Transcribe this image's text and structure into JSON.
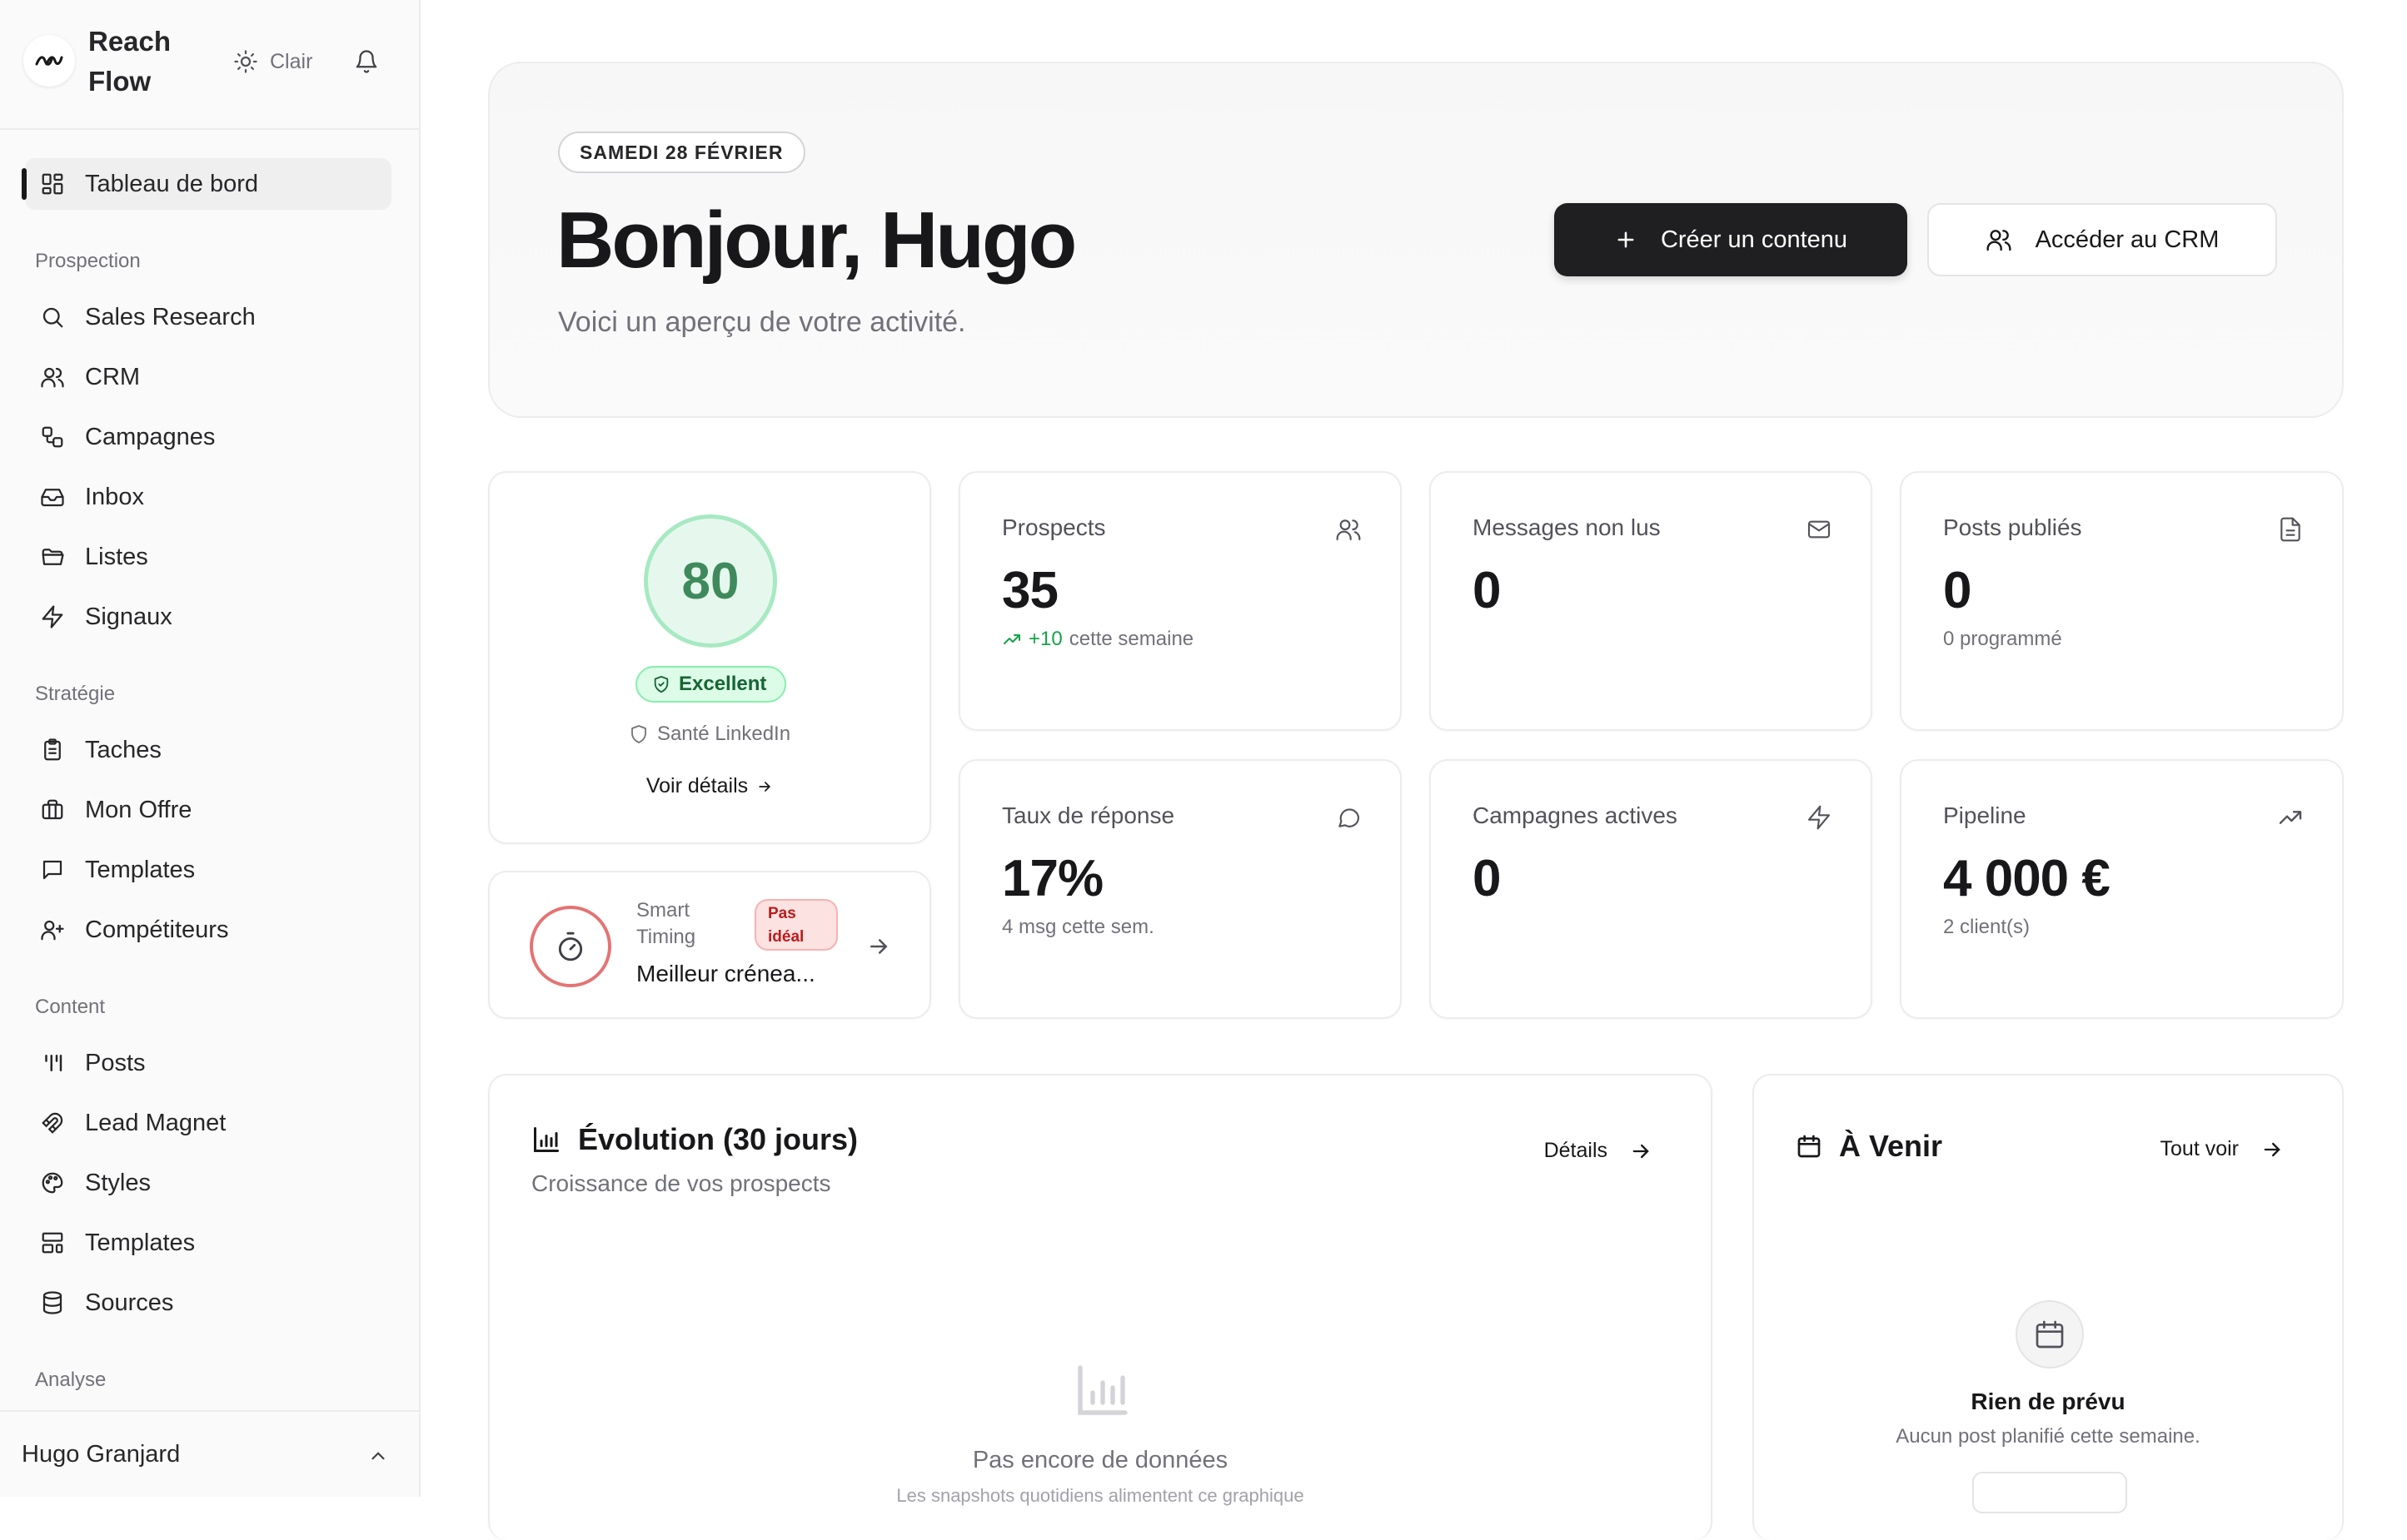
{
  "brand": {
    "name": "Reach Flow",
    "theme_label": "Clair"
  },
  "sidebar": {
    "dashboard": "Tableau de bord",
    "sections": {
      "prospection": "Prospection",
      "strategie": "Stratégie",
      "content": "Content",
      "analyse": "Analyse"
    },
    "prospection_items": [
      "Sales Research",
      "CRM",
      "Campagnes",
      "Inbox",
      "Listes",
      "Signaux"
    ],
    "strategie_items": [
      "Taches",
      "Mon Offre",
      "Templates",
      "Compétiteurs"
    ],
    "content_items": [
      "Posts",
      "Lead Magnet",
      "Styles",
      "Templates",
      "Sources"
    ],
    "user_name": "Hugo Granjard"
  },
  "hero": {
    "date": "SAMEDI 28 FÉVRIER",
    "title": "Bonjour, Hugo",
    "subtitle": "Voici un aperçu de votre activité.",
    "primary_button": "Créer un contenu",
    "secondary_button": "Accéder au CRM"
  },
  "score": {
    "value": "80",
    "badge": "Excellent",
    "label": "Santé LinkedIn",
    "link": "Voir détails"
  },
  "timing": {
    "label": "Smart Timing",
    "badge": "Pas idéal",
    "value": "Meilleur crénea..."
  },
  "stats": {
    "prospects": {
      "label": "Prospects",
      "value": "35",
      "delta": "+10",
      "sub": "cette semaine"
    },
    "messages": {
      "label": "Messages non lus",
      "value": "0"
    },
    "posts": {
      "label": "Posts publiés",
      "value": "0",
      "sub": "0 programmé"
    },
    "reply": {
      "label": "Taux de réponse",
      "value": "17%",
      "sub": "4 msg cette sem."
    },
    "campaigns": {
      "label": "Campagnes actives",
      "value": "0"
    },
    "pipeline": {
      "label": "Pipeline",
      "value": "4 000 €",
      "sub": "2 client(s)"
    }
  },
  "evolution": {
    "title": "Évolution (30 jours)",
    "subtitle": "Croissance de vos prospects",
    "details": "Détails",
    "empty_title": "Pas encore de données",
    "empty_sub": "Les snapshots quotidiens alimentent ce graphique"
  },
  "upcoming": {
    "title": "À Venir",
    "link": "Tout voir",
    "empty_title": "Rien de prévu",
    "empty_sub": "Aucun post planifié cette semaine."
  },
  "colors": {
    "accent_dark": "#1f1f21",
    "success": "#16a34a",
    "danger": "#e57373",
    "muted_text": "#71717a"
  }
}
